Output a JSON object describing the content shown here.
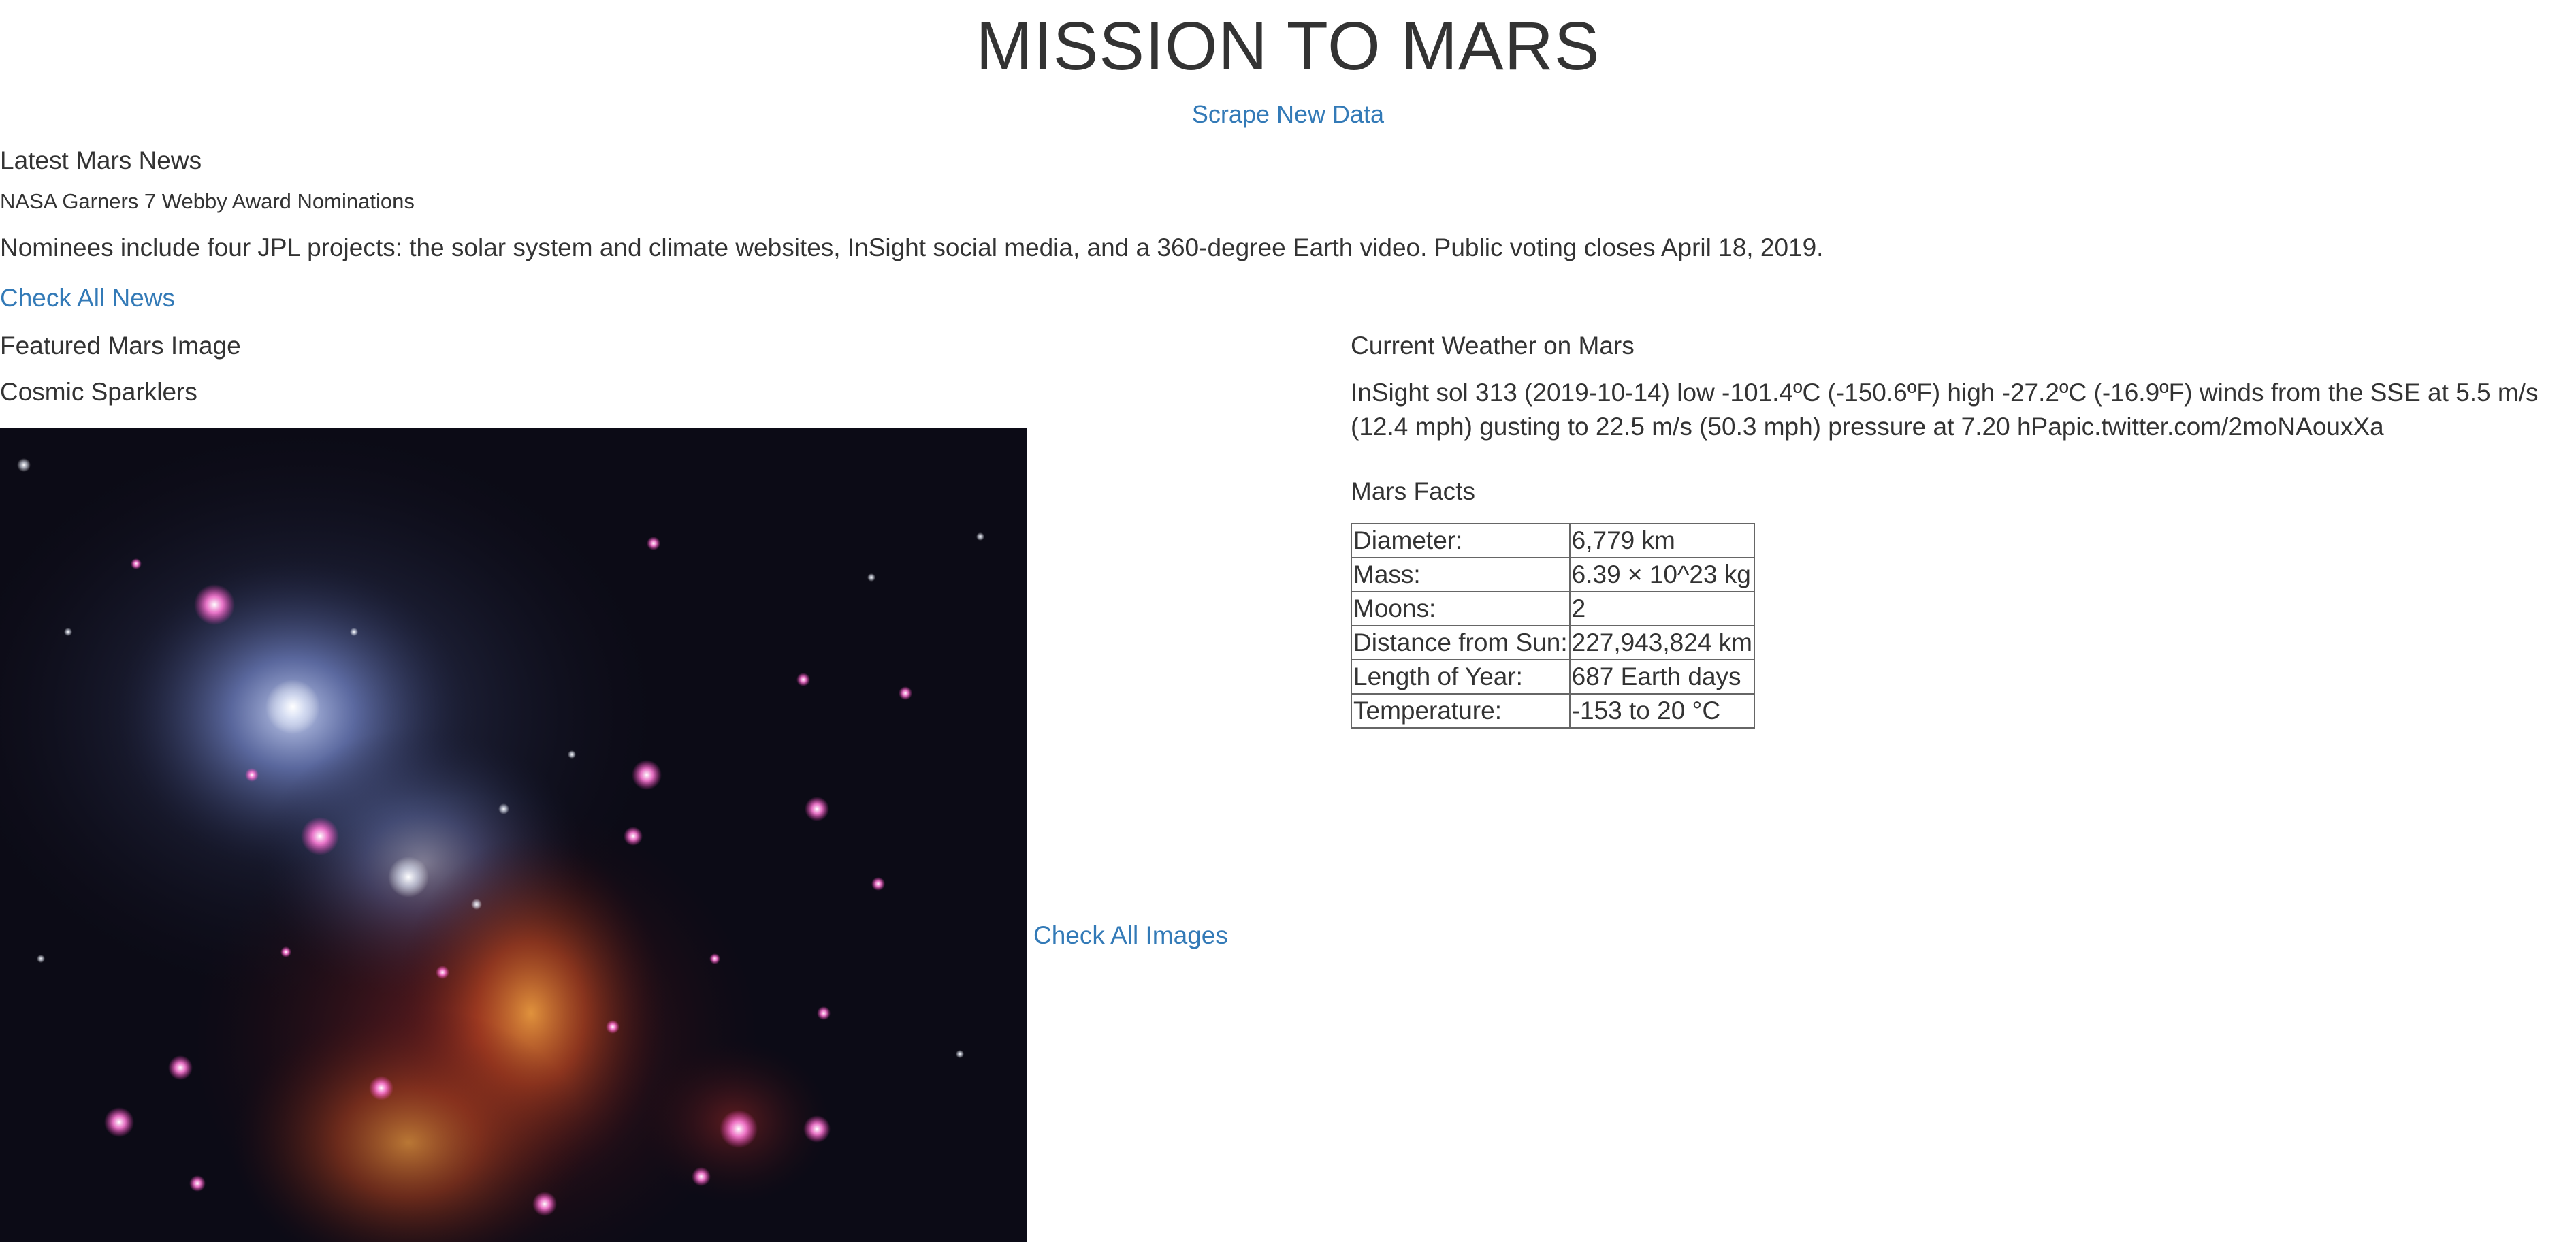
{
  "header": {
    "title": "MISSION TO MARS",
    "scrape_link": "Scrape New Data"
  },
  "news": {
    "heading": "Latest Mars News",
    "title": "NASA Garners 7 Webby Award Nominations",
    "teaser": "Nominees include four JPL projects: the solar system and climate websites, InSight social media, and a 360-degree Earth video. Public voting closes April 18, 2019.",
    "check_link": "Check All News"
  },
  "featured": {
    "heading": "Featured Mars Image",
    "image_title": "Cosmic Sparklers",
    "check_link": "Check All Images"
  },
  "weather": {
    "heading": "Current Weather on Mars",
    "text": "InSight sol 313 (2019-10-14) low -101.4ºC (-150.6ºF) high -27.2ºC (-16.9ºF) winds from the SSE at 5.5 m/s (12.4 mph) gusting to 22.5 m/s (50.3 mph) pressure at 7.20 hPapic.twitter.com/2moNAouxXa"
  },
  "facts": {
    "heading": "Mars Facts",
    "rows": [
      {
        "label": "Diameter:",
        "value": "6,779 km"
      },
      {
        "label": "Mass:",
        "value": "6.39 × 10^23 kg"
      },
      {
        "label": "Moons:",
        "value": "2"
      },
      {
        "label": "Distance from Sun:",
        "value": "227,943,824 km"
      },
      {
        "label": "Length of Year:",
        "value": "687 Earth days"
      },
      {
        "label": "Temperature:",
        "value": "-153 to 20 °C"
      }
    ]
  },
  "colors": {
    "link": "#337ab7",
    "text": "#333333",
    "table_border": "#666666"
  }
}
